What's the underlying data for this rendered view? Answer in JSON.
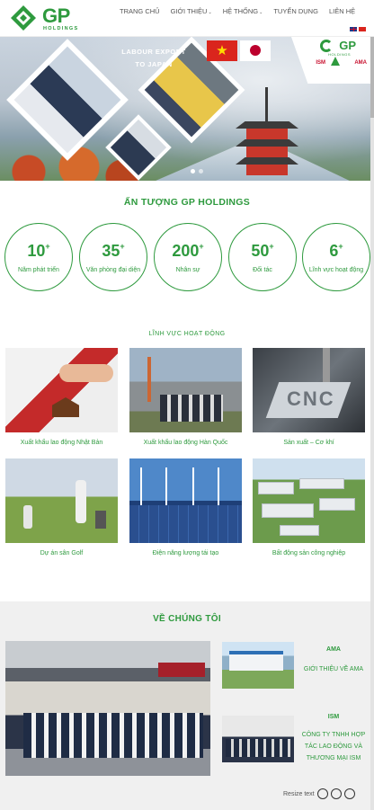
{
  "header": {
    "logo": {
      "brand": "GP",
      "sub": "HOLDINGS"
    },
    "nav": [
      {
        "label": "TRANG CHỦ",
        "has_caret": false
      },
      {
        "label": "GIỚI THIỆU",
        "has_caret": true
      },
      {
        "label": "HỆ THỐNG",
        "has_caret": true
      },
      {
        "label": "TUYỂN DỤNG",
        "has_caret": false
      },
      {
        "label": "LIÊN HỆ",
        "has_caret": false
      }
    ],
    "languages": [
      "en",
      "vi"
    ]
  },
  "hero": {
    "title_line1": "LABOUR EXPORT",
    "title_line2": "TO JAPAN",
    "corner_brand": "GP",
    "corner_sub": "HOLDINGS",
    "partner_left": "ISM",
    "partner_right": "AMA",
    "slide_count": 2,
    "active_slide": 0
  },
  "impressions": {
    "title": "ẤN TƯỢNG GP HOLDINGS",
    "stats": [
      {
        "value": "10",
        "suffix": "+",
        "label": "Năm phát triển"
      },
      {
        "value": "35",
        "suffix": "+",
        "label": "Văn phòng đại diện"
      },
      {
        "value": "200",
        "suffix": "+",
        "label": "Nhân sự"
      },
      {
        "value": "50",
        "suffix": "+",
        "label": "Đối tác"
      },
      {
        "value": "6",
        "suffix": "+",
        "label": "Lĩnh vực hoạt động"
      }
    ]
  },
  "fields": {
    "title": "LĨNH VỰC HOẠT ĐỘNG",
    "items": [
      {
        "label": "Xuất khẩu lao động Nhật Bản"
      },
      {
        "label": "Xuất khẩu lao động Hàn Quốc"
      },
      {
        "label": "Sản xuất – Cơ khí"
      },
      {
        "label": "Dự án sân Golf"
      },
      {
        "label": "Điện năng lượng tái tạo"
      },
      {
        "label": "Bất động sản công nghiệp"
      }
    ]
  },
  "about": {
    "title": "VỀ CHÚNG TÔI",
    "items": [
      {
        "name": "AMA",
        "desc": "GIỚI THIỆU VỀ AMA"
      },
      {
        "name": "ISM",
        "desc": "CÔNG TY TNHH HỢP TÁC LAO ĐỘNG VÀ THƯƠNG MẠI ISM"
      }
    ]
  },
  "accessibility": {
    "resize_label": "Resize text"
  },
  "colors": {
    "brand_green": "#2e9a3e",
    "accent_red": "#c8102e"
  }
}
